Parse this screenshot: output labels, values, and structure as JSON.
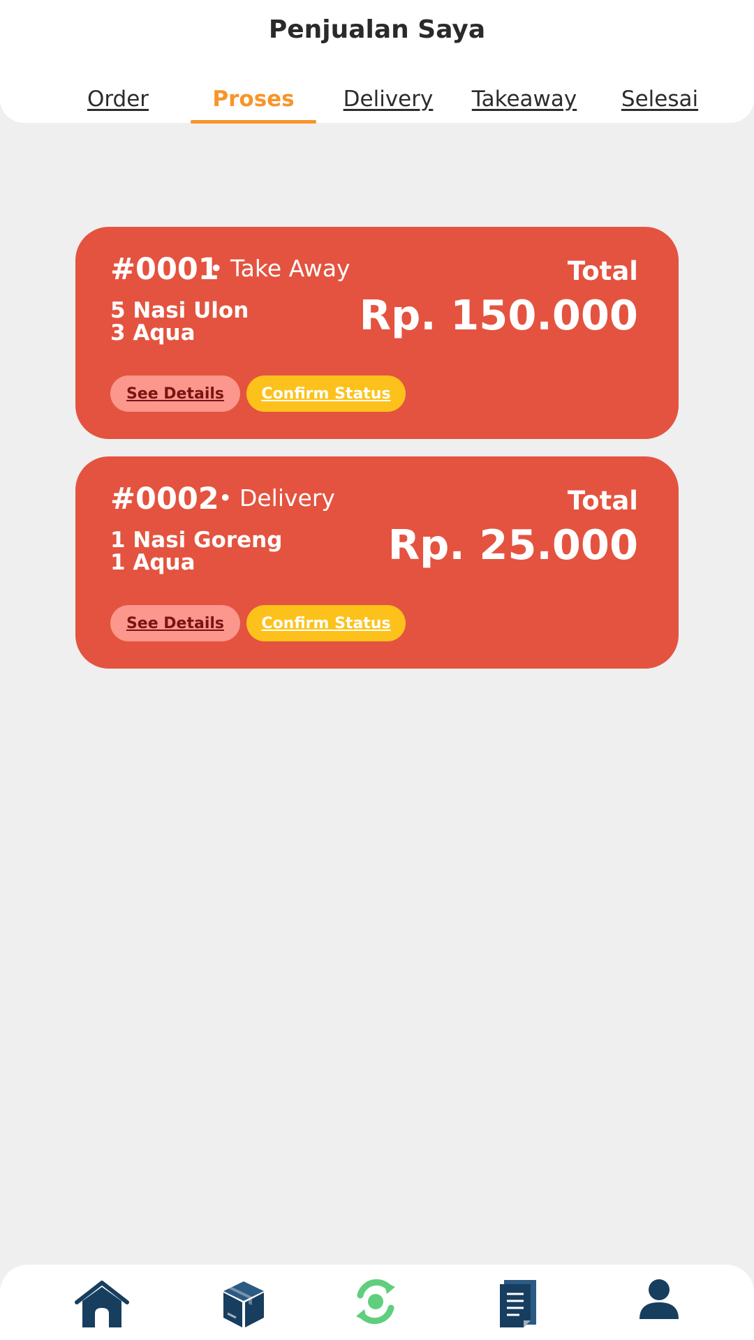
{
  "header": {
    "title": "Penjualan Saya"
  },
  "tabs": [
    {
      "label": "Order",
      "active": false
    },
    {
      "label": "Proses",
      "active": true
    },
    {
      "label": "Delivery",
      "active": false
    },
    {
      "label": "Takeaway",
      "active": false
    },
    {
      "label": "Selesai",
      "active": false
    }
  ],
  "orders": [
    {
      "id": "#0001",
      "type": "Take Away",
      "items": [
        "5 Nasi Ulon",
        "3 Aqua"
      ],
      "total_label": "Total",
      "total": "Rp. 150.000",
      "details_label": "See Details",
      "confirm_label": "Confirm Status"
    },
    {
      "id": "#0002",
      "type": "Delivery",
      "items": [
        "1 Nasi Goreng",
        "1 Aqua"
      ],
      "total_label": "Total",
      "total": "Rp. 25.000",
      "details_label": "See Details",
      "confirm_label": "Confirm Status"
    }
  ],
  "bottom_nav": [
    {
      "icon": "home-icon"
    },
    {
      "icon": "package-icon"
    },
    {
      "icon": "process-icon",
      "active": true
    },
    {
      "icon": "document-icon"
    },
    {
      "icon": "profile-icon"
    }
  ],
  "colors": {
    "accent": "#f7952a",
    "card": "#e4533f",
    "details_button": "#fb978c",
    "confirm_button": "#fcc21b",
    "nav_icon": "#173e5f",
    "nav_active": "#5fcf7d"
  }
}
